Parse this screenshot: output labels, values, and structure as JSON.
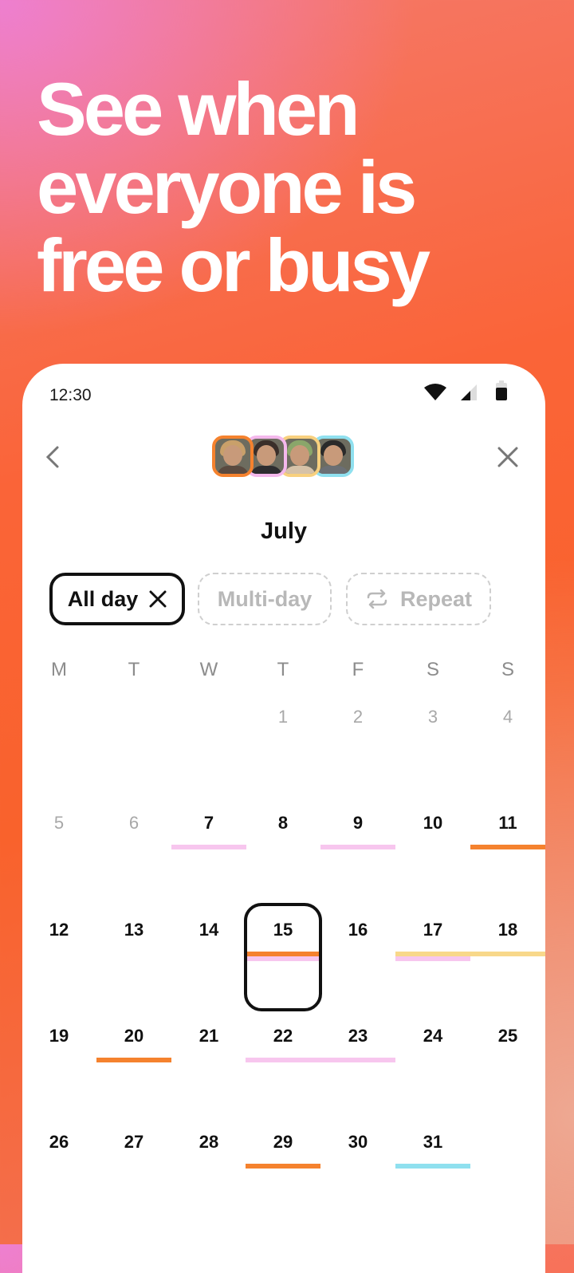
{
  "headline": [
    "See when",
    "everyone is",
    "free or busy"
  ],
  "status_bar": {
    "time": "12:30",
    "icons": [
      "wifi-icon",
      "signal-icon",
      "battery-icon"
    ]
  },
  "header": {
    "back_icon": "chevron-left-icon",
    "close_icon": "close-icon",
    "avatars": [
      {
        "name": "friend-1",
        "ring_color": "#f5822e"
      },
      {
        "name": "friend-2",
        "ring_color": "#f4b8ec"
      },
      {
        "name": "friend-3",
        "ring_color": "#f8d07e"
      },
      {
        "name": "friend-4",
        "ring_color": "#8fe0ef"
      }
    ]
  },
  "month": "July",
  "chips": [
    {
      "label": "All day",
      "state": "selected",
      "icon": "close-icon"
    },
    {
      "label": "Multi-day",
      "state": "unselected"
    },
    {
      "label": "Repeat",
      "state": "unselected",
      "icon": "repeat-icon"
    }
  ],
  "weekdays": [
    "M",
    "T",
    "W",
    "T",
    "F",
    "S",
    "S"
  ],
  "colors": {
    "orange": "#f5822e",
    "pink": "#f7c6ee",
    "yellow": "#f8d88a",
    "blue": "#8fe0ef"
  },
  "calendar_weeks": [
    [
      {
        "d": ""
      },
      {
        "d": ""
      },
      {
        "d": ""
      },
      {
        "d": "1",
        "muted": true
      },
      {
        "d": "2",
        "muted": true
      },
      {
        "d": "3",
        "muted": true
      },
      {
        "d": "4",
        "muted": true
      }
    ],
    [
      {
        "d": "5",
        "muted": true
      },
      {
        "d": "6",
        "muted": true
      },
      {
        "d": "7",
        "bars": [
          "pink"
        ]
      },
      {
        "d": "8"
      },
      {
        "d": "9",
        "bars": [
          "pink"
        ]
      },
      {
        "d": "10"
      },
      {
        "d": "11",
        "bars": [
          "orange"
        ]
      }
    ],
    [
      {
        "d": "12"
      },
      {
        "d": "13"
      },
      {
        "d": "14"
      },
      {
        "d": "15",
        "bars": [
          "orange",
          "pink"
        ],
        "selected": true
      },
      {
        "d": "16"
      },
      {
        "d": "17",
        "bars": [
          "yellow",
          "pink"
        ]
      },
      {
        "d": "18",
        "bars": [
          "yellow"
        ]
      }
    ],
    [
      {
        "d": "19"
      },
      {
        "d": "20",
        "bars": [
          "orange"
        ]
      },
      {
        "d": "21"
      },
      {
        "d": "22",
        "bars": [
          "pink"
        ]
      },
      {
        "d": "23",
        "bars": [
          "pink"
        ]
      },
      {
        "d": "24"
      },
      {
        "d": "25"
      }
    ],
    [
      {
        "d": "26"
      },
      {
        "d": "27"
      },
      {
        "d": "28"
      },
      {
        "d": "29",
        "bars": [
          "orange"
        ]
      },
      {
        "d": "30"
      },
      {
        "d": "31",
        "bars": [
          "blue"
        ]
      },
      {
        "d": ""
      }
    ]
  ]
}
